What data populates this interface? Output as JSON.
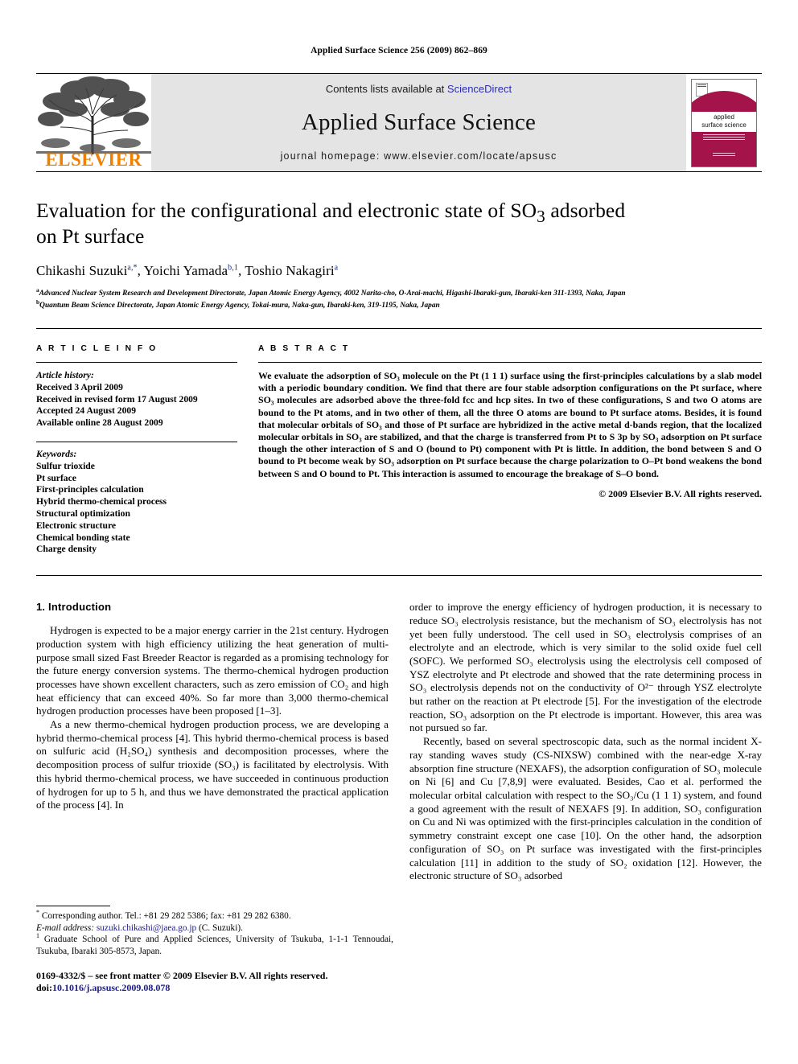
{
  "running_head": "Applied Surface Science 256 (2009) 862–869",
  "masthead": {
    "publisher": "ELSEVIER",
    "contents_prefix": "Contents lists available at ",
    "contents_link": "ScienceDirect",
    "journal_title": "Applied Surface Science",
    "homepage": "journal homepage: www.elsevier.com/locate/apsusc",
    "cover_label_line1": "applied",
    "cover_label_line2": "surface science"
  },
  "article": {
    "title_line1": "Evaluation for the configurational and electronic state of SO",
    "title_sub1": "3",
    "title_line1_tail": " adsorbed",
    "title_line2": "on Pt surface",
    "authors": [
      {
        "name": "Chikashi Suzuki",
        "marks": "a,*"
      },
      {
        "name": "Yoichi Yamada",
        "marks": "b,1"
      },
      {
        "name": "Toshio Nakagiri",
        "marks": "a"
      }
    ],
    "affiliations": [
      {
        "mark": "a",
        "text": "Advanced Nuclear System Research and Development Directorate, Japan Atomic Energy Agency, 4002 Narita-cho, O-Arai-machi, Higashi-Ibaraki-gun, Ibaraki-ken 311-1393, Naka, Japan"
      },
      {
        "mark": "b",
        "text": "Quantum Beam Science Directorate, Japan Atomic Energy Agency, Tokai-mura, Naka-gun, Ibaraki-ken, 319-1195, Naka, Japan"
      }
    ]
  },
  "article_info": {
    "heading": "A R T I C L E  I N F O",
    "history_label": "Article history:",
    "history": [
      "Received 3 April 2009",
      "Received in revised form 17 August 2009",
      "Accepted 24 August 2009",
      "Available online 28 August 2009"
    ],
    "keywords_label": "Keywords:",
    "keywords": [
      "Sulfur trioxide",
      "Pt surface",
      "First-principles calculation",
      "Hybrid thermo-chemical process",
      "Structural optimization",
      "Electronic structure",
      "Chemical bonding state",
      "Charge density"
    ]
  },
  "abstract": {
    "heading": "A B S T R A C T",
    "text": "We evaluate the adsorption of SO₃ molecule on the Pt (1 1 1) surface using the first-principles calculations by a slab model with a periodic boundary condition. We find that there are four stable adsorption configurations on the Pt surface, where SO₃ molecules are adsorbed above the three-fold fcc and hcp sites. In two of these configurations, S and two O atoms are bound to the Pt atoms, and in two other of them, all the three O atoms are bound to Pt surface atoms. Besides, it is found that molecular orbitals of SO₃ and those of Pt surface are hybridized in the active metal d-bands region, that the localized molecular orbitals in SO₃ are stabilized, and that the charge is transferred from Pt to S 3p by SO₃ adsorption on Pt surface though the other interaction of S and O (bound to Pt) component with Pt is little. In addition, the bond between S and O bound to Pt become weak by SO₃ adsorption on Pt surface because the charge polarization to O–Pt bond weakens the bond between S and O bound to Pt. This interaction is assumed to encourage the breakage of S–O bond.",
    "copyright": "© 2009 Elsevier B.V. All rights reserved."
  },
  "introduction": {
    "heading": "1. Introduction",
    "left_paragraphs": [
      "Hydrogen is expected to be a major energy carrier in the 21st century. Hydrogen production system with high efficiency utilizing the heat generation of multi-purpose small sized Fast Breeder Reactor is regarded as a promising technology for the future energy conversion systems. The thermo-chemical hydrogen production processes have shown excellent characters, such as zero emission of CO₂ and high heat efficiency that can exceed 40%. So far more than 3,000 thermo-chemical hydrogen production processes have been proposed [1–3].",
      "As a new thermo-chemical hydrogen production process, we are developing a hybrid thermo-chemical process [4]. This hybrid thermo-chemical process is based on sulfuric acid (H₂SO₄) synthesis and decomposition processes, where the decomposition process of sulfur trioxide (SO₃) is facilitated by electrolysis. With this hybrid thermo-chemical process, we have succeeded in continuous production of hydrogen for up to 5 h, and thus we have demonstrated the practical application of the process [4]. In"
    ],
    "right_paragraphs": [
      "order to improve the energy efficiency of hydrogen production, it is necessary to reduce SO₃ electrolysis resistance, but the mechanism of SO₃ electrolysis has not yet been fully understood. The cell used in SO₃ electrolysis comprises of an electrolyte and an electrode, which is very similar to the solid oxide fuel cell (SOFC). We performed SO₃ electrolysis using the electrolysis cell composed of YSZ electrolyte and Pt electrode and showed that the rate determining process in SO₃ electrolysis depends not on the conductivity of O²⁻ through YSZ electrolyte but rather on the reaction at Pt electrode [5]. For the investigation of the electrode reaction, SO₃ adsorption on the Pt electrode is important. However, this area was not pursued so far.",
      "Recently, based on several spectroscopic data, such as the normal incident X-ray standing waves study (CS-NIXSW) combined with the near-edge X-ray absorption fine structure (NEXAFS), the adsorption configuration of SO₃ molecule on Ni [6] and Cu [7,8,9] were evaluated. Besides, Cao et al. performed the molecular orbital calculation with respect to the SO₃/Cu (1 1 1) system, and found a good agreement with the result of NEXAFS [9]. In addition, SO₃ configuration on Cu and Ni was optimized with the first-principles calculation in the condition of symmetry constraint except one case [10]. On the other hand, the adsorption configuration of SO₃ on Pt surface was investigated with the first-principles calculation [11] in addition to the study of SO₂ oxidation [12]. However, the electronic structure of SO₃ adsorbed"
    ]
  },
  "footnotes": {
    "corresponding": "Corresponding author. Tel.: +81 29 282 5386; fax: +81 29 282 6380.",
    "email_label": "E-mail address:",
    "email": "suzuki.chikashi@jaea.go.jp",
    "email_suffix": "(C. Suzuki).",
    "note1": "Graduate School of Pure and Applied Sciences, University of Tsukuba, 1-1-1 Tennoudai, Tsukuba, Ibaraki 305-8573, Japan."
  },
  "imprint": {
    "line1": "0169-4332/$ – see front matter © 2009 Elsevier B.V. All rights reserved.",
    "doi_label": "doi:",
    "doi": "10.1016/j.apsusc.2009.08.078"
  },
  "colors": {
    "link": "#2b2bbb",
    "reference": "#1a1a8c",
    "elsevier_orange": "#F08000",
    "cover_magenta": "#A5134B",
    "band_gray": "#e4e4e4"
  }
}
